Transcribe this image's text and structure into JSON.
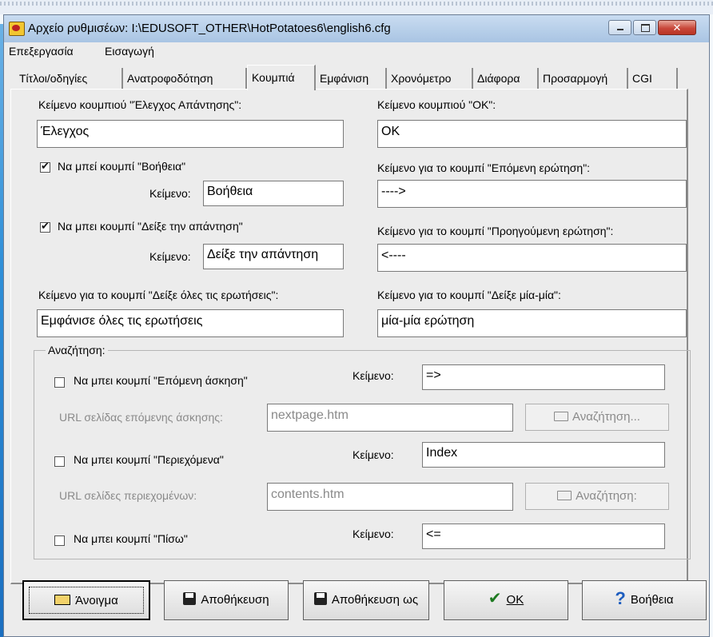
{
  "window": {
    "title": "Αρχείο ρυθμισέων: I:\\EDUSOFT_OTHER\\HotPotatoes6\\english6.cfg",
    "close_glyph": "✕"
  },
  "menu": [
    "Επεξεργασία",
    "Εισαγωγή"
  ],
  "tabs": [
    {
      "label": "Τίτλοι/οδηγίες",
      "active": false
    },
    {
      "label": "Ανατροφοδότηση",
      "active": false
    },
    {
      "label": "Κουμπιά",
      "active": true
    },
    {
      "label": "Εμφάνιση",
      "active": false
    },
    {
      "label": "Χρονόμετρο",
      "active": false
    },
    {
      "label": "Διάφορα",
      "active": false
    },
    {
      "label": "Προσαρμογή",
      "active": false
    },
    {
      "label": "CGI",
      "active": false
    }
  ],
  "buttons_tab": {
    "check": {
      "label": "Κείμενο κουμπιού \"Έλεγχος Απάντησης\":",
      "value": "Έλεγχος"
    },
    "ok": {
      "label": "Κείμενο κουμπιού \"OK\":",
      "value": "OK"
    },
    "hint": {
      "checkbox_label": "Να μπεί κουμπί \"Βοήθεια\"",
      "checked": true,
      "text_label": "Κείμενο:",
      "value": "Βοήθεια"
    },
    "next_q": {
      "label": "Κείμενο για το κουμπί \"Επόμενη ερώτηση\":",
      "value": "---->"
    },
    "show_answer": {
      "checkbox_label": "Να μπει κουμπί \"Δείξε την απάντηση\"",
      "checked": true,
      "text_label": "Κείμενο:",
      "value": "Δείξε την απάντηση"
    },
    "prev_q": {
      "label": "Κείμενο για το κουμπί \"Προηγούμενη ερώτηση\":",
      "value": "<----"
    },
    "show_all": {
      "label": "Κείμενο για το κουμπί \"Δείξε όλες τις ερωτήσεις\":",
      "value": "Εμφάνισε όλες τις ερωτήσεις"
    },
    "one_by_one": {
      "label": "Κείμενο για το κουμπί \"Δείξε μία-μία\":",
      "value": "μία-μία ερώτηση"
    }
  },
  "navigation": {
    "title": "Αναζήτηση:",
    "next_exercise": {
      "checkbox_label": "Να μπει κουμπί \"Επόμενη άσκηση\"",
      "checked": false,
      "text_label": "Κείμενο:",
      "value": "=>",
      "url_label": "URL σελίδας επόμενης άσκησης:",
      "url": "nextpage.htm",
      "browse_label": "Αναζήτηση..."
    },
    "contents": {
      "checkbox_label": "Να μπει κουμπί \"Περιεχόμενα\"",
      "checked": false,
      "text_label": "Κείμενο:",
      "value": "Index",
      "url_label": "URL σελίδες περιεχομένων:",
      "url": "contents.htm",
      "browse_label": "Αναζήτηση:"
    },
    "back": {
      "checkbox_label": "Να μπει κουμπί \"Πίσω\"",
      "checked": false,
      "text_label": "Κείμενο:",
      "value": "<="
    }
  },
  "footer": {
    "open": "Άνοιγμα",
    "save": "Αποθήκευση",
    "save_as": "Αποθήκευση ως",
    "ok": "OK",
    "help": "Βοήθεια"
  }
}
